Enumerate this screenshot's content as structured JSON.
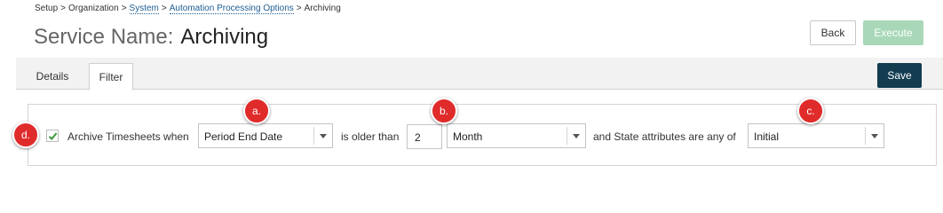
{
  "breadcrumb": {
    "setup": "Setup",
    "sep1": ">",
    "organization": "Organization",
    "sep2": ">",
    "system": "System",
    "sep3": ">",
    "automation": "Automation Processing Options",
    "sep4": ">",
    "current": "Archiving"
  },
  "header": {
    "title_label": "Service Name:",
    "title_value": "Archiving",
    "back_label": "Back",
    "execute_label": "Execute"
  },
  "tabs": {
    "details": "Details",
    "filter": "Filter",
    "save_label": "Save"
  },
  "filter": {
    "checkbox_checked": true,
    "archive_label": "Archive Timesheets when",
    "date_field": "Period End Date",
    "older_than_label": "is older than",
    "amount": "2",
    "unit": "Month",
    "state_label": "and State attributes are any of",
    "state_value": "Initial"
  },
  "markers": {
    "a": "a.",
    "b": "b.",
    "c": "c.",
    "d": "d."
  },
  "colors": {
    "link": "#1f5e92",
    "save_button": "#123c50",
    "execute_button_disabled": "#a9d8b8",
    "marker": "#e02b2b",
    "checkmark": "#3a9a3a"
  }
}
